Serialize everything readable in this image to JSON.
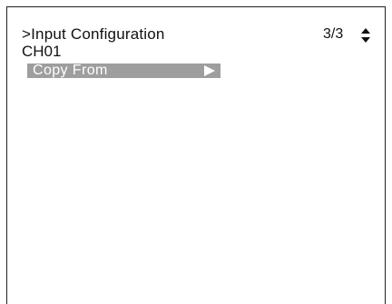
{
  "menu": {
    "title": ">Input Configuration",
    "page": "3/3",
    "channel": "CH01",
    "items": [
      {
        "label": "Copy From",
        "selected": true,
        "icon": "submenu-arrow-icon"
      }
    ]
  },
  "icons": {
    "scroll": "up-down-scroll-icon"
  },
  "colors": {
    "background": "#ffffff",
    "text": "#111111",
    "highlight": "#9e9e9e",
    "highlight_text": "#ffffff"
  }
}
